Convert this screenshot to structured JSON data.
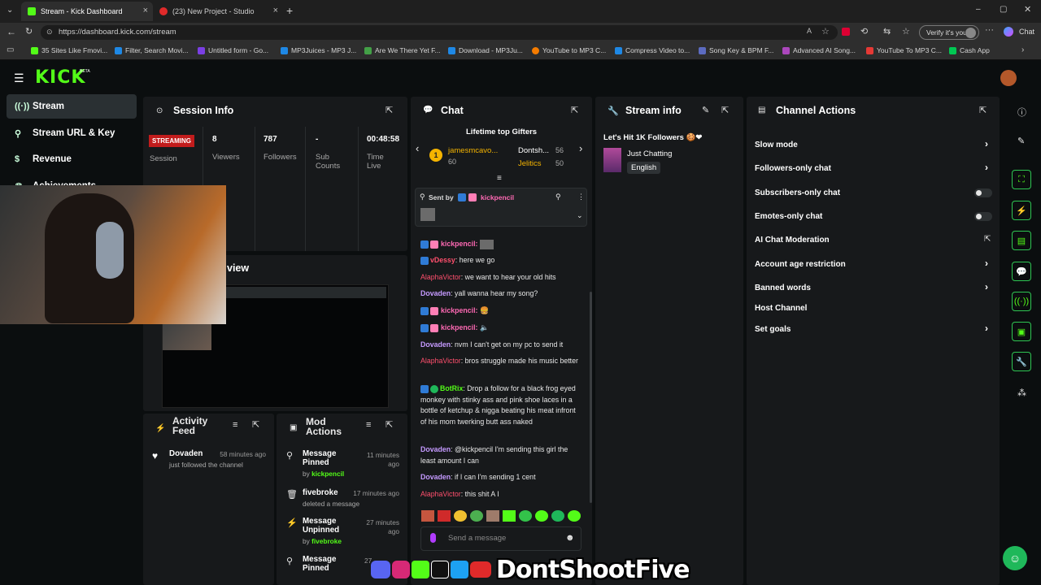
{
  "browser": {
    "tabs": [
      {
        "title": "Stream - Kick Dashboard",
        "active": true
      },
      {
        "title": "(23) New Project - Studio",
        "active": false
      }
    ],
    "url": "https://dashboard.kick.com/stream",
    "verify_label": "Verify it's you",
    "chat_label": "Chat",
    "bookmarks": [
      "35 Sites Like Fmovi...",
      "Filter, Search Movi...",
      "Untitled form - Go...",
      "MP3Juices - MP3 J...",
      "Are We There Yet F...",
      "Download - MP3Ju...",
      "YouTube to MP3 C...",
      "Compress Video to...",
      "Song Key & BPM F...",
      "Advanced AI Song...",
      "YouTube To MP3 C...",
      "Cash App"
    ]
  },
  "app": {
    "logo": "KICK",
    "logo_badge": "BETA"
  },
  "sidebar": {
    "items": [
      {
        "label": "Stream",
        "icon": "stream-icon"
      },
      {
        "label": "Stream URL & Key",
        "icon": "link-icon"
      },
      {
        "label": "Revenue",
        "icon": "dollar-icon"
      },
      {
        "label": "Achievements",
        "icon": "trophy-icon"
      }
    ]
  },
  "session": {
    "title": "Session Info",
    "status": "STREAMING",
    "status_label": "Session",
    "stats": [
      {
        "value": "8",
        "label": "Viewers"
      },
      {
        "value": "787",
        "label": "Followers"
      },
      {
        "value": "-",
        "label": "Sub Counts"
      },
      {
        "value": "00:48:58",
        "label": "Time Live"
      }
    ]
  },
  "preview": {
    "title": "view"
  },
  "activity": {
    "title": "Activity Feed",
    "items": [
      {
        "name": "Dovaden",
        "time": "58 minutes ago",
        "text": "just followed the channel"
      }
    ]
  },
  "mod": {
    "title": "Mod Actions",
    "items": [
      {
        "title": "Message Pinned",
        "by": "by",
        "user": "kickpencil",
        "time": "11 minutes ago"
      },
      {
        "title": "fivebroke",
        "sub": "deleted a message",
        "time": "17 minutes ago"
      },
      {
        "title": "Message Unpinned",
        "by": "by",
        "user": "fivebroke",
        "time": "27 minutes ago"
      },
      {
        "title": "Message Pinned",
        "time": "27"
      }
    ]
  },
  "chat": {
    "title": "Chat",
    "gifters_title": "Lifetime top Gifters",
    "gifters": [
      {
        "name": "jamesmcavo...",
        "amount": "60",
        "rank": "1"
      },
      {
        "name": "Dontsh...",
        "amount": "56"
      },
      {
        "name": "Jelitics",
        "amount": "50"
      }
    ],
    "pinned": {
      "sent_by": "Sent by",
      "user": "kickpencil"
    },
    "messages": [
      {
        "user": "kickpencil:",
        "text": ""
      },
      {
        "user": "vDessy",
        "text": ": here we go"
      },
      {
        "user": "AlaphaVictor",
        "text": ": we want to hear your old hits"
      },
      {
        "user": "Dovaden",
        "text": ": yall wanna hear my song?"
      },
      {
        "user": "kickpencil:",
        "text": ""
      },
      {
        "user": "kickpencil:",
        "text": ""
      },
      {
        "user": "Dovaden",
        "text": ": nvm I can't get on my pc to send it"
      },
      {
        "user": "AlaphaVictor",
        "text": ": bros struggle made his music better"
      },
      {
        "user": "BotRix",
        "text": ": Drop a follow for a black frog eyed monkey with stinky ass and pink shoe laces in a bottle of ketchup & nigga beating his meat infront of his mom twerking butt ass naked"
      },
      {
        "user": "Dovaden",
        "text": ": @kickpencil I'm sending this girl the least amount I can"
      },
      {
        "user": "Dovaden",
        "text": ": if I can I'm sending 1 cent"
      },
      {
        "user": "AlaphaVictor",
        "text": ": this shit A I"
      }
    ],
    "input_placeholder": "Send a message"
  },
  "stream_info": {
    "title": "Stream info",
    "stream_title": "Let's Hit 1K Followers",
    "category": "Just Chatting",
    "language": "English"
  },
  "channel_actions": {
    "title": "Channel Actions",
    "items": [
      {
        "label": "Slow mode",
        "control": "chevron"
      },
      {
        "label": "Followers-only chat",
        "control": "chevron"
      },
      {
        "label": "Subscribers-only chat",
        "control": "toggle"
      },
      {
        "label": "Emotes-only chat",
        "control": "toggle"
      },
      {
        "label": "AI Chat Moderation",
        "control": "external"
      },
      {
        "label": "Account age restriction",
        "control": "chevron"
      },
      {
        "label": "Banned words",
        "control": "chevron"
      },
      {
        "label": "Host Channel",
        "control": "none"
      },
      {
        "label": "Set goals",
        "control": "chevron"
      }
    ]
  },
  "watermark": {
    "text": "DontShootFive"
  },
  "colors": {
    "kick_green": "#53fc18",
    "bg": "#0b0e0f",
    "panel": "#17191b",
    "streaming_red": "#e02a2a"
  }
}
